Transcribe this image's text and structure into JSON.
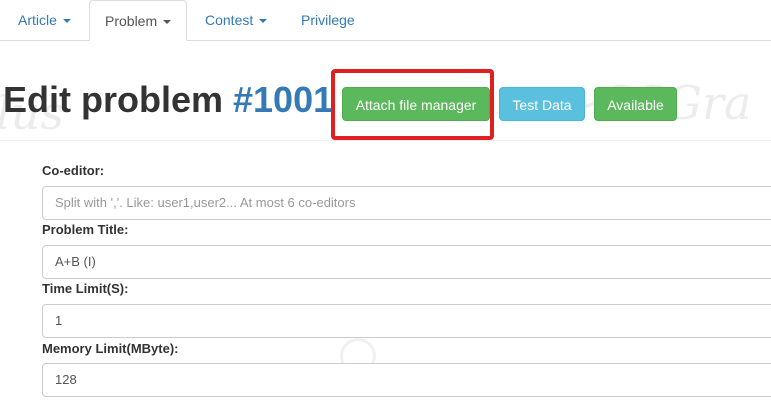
{
  "nav": {
    "items": [
      {
        "label": "Article",
        "dropdown": true
      },
      {
        "label": "Problem",
        "dropdown": true,
        "active": true
      },
      {
        "label": "Contest",
        "dropdown": true
      },
      {
        "label": "Privilege",
        "dropdown": false
      }
    ]
  },
  "header": {
    "title_prefix": "Edit problem ",
    "problem_id": "#1001"
  },
  "actions": {
    "attach_label": "Attach file manager",
    "test_data_label": "Test Data",
    "available_label": "Available"
  },
  "form": {
    "coeditor": {
      "label": "Co-editor:",
      "value": "",
      "placeholder": "Split with ','. Like: user1,user2... At most 6 co-editors"
    },
    "title": {
      "label": "Problem Title:",
      "value": "A+B (I)"
    },
    "time_limit": {
      "label": "Time Limit(S):",
      "value": "1"
    },
    "memory_limit": {
      "label": "Memory Limit(MByte):",
      "value": "128"
    }
  },
  "colors": {
    "link": "#337ab7",
    "success": "#5cb85c",
    "info": "#5bc0de",
    "highlight": "#e02020"
  }
}
